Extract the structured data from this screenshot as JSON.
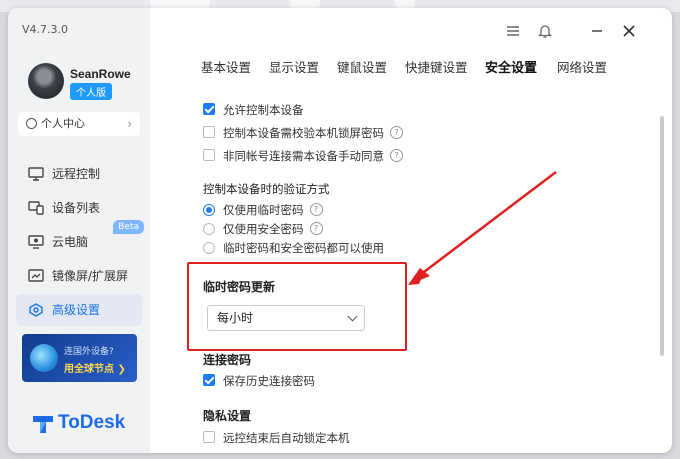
{
  "app": {
    "version": "V4.7.3.0",
    "user": {
      "name": "SeanRowe",
      "plan_badge": "个人版"
    },
    "personal_center": "个人中心"
  },
  "sidebar": {
    "items": [
      {
        "label": "远程控制",
        "icon": "monitor-icon"
      },
      {
        "label": "设备列表",
        "icon": "devices-icon"
      },
      {
        "label": "云电脑",
        "icon": "cloud-pc-icon",
        "badge": "Beta"
      },
      {
        "label": "镜像屏/扩展屏",
        "icon": "mirror-screen-icon"
      },
      {
        "label": "高级设置",
        "icon": "advanced-settings-icon",
        "active": true
      }
    ],
    "promo": {
      "line1": "连国外设备?",
      "line2": "用全球节点 ❯"
    },
    "brand": "ToDesk"
  },
  "tabs": [
    "基本设置",
    "显示设置",
    "键鼠设置",
    "快捷键设置",
    "安全设置",
    "网络设置"
  ],
  "active_tab": "安全设置",
  "security": {
    "allow_control": {
      "label": "允许控制本设备",
      "checked": true
    },
    "require_lock_password": {
      "label": "控制本设备需校验本机锁屏密码",
      "checked": false
    },
    "manual_consent": {
      "label": "非同帐号连接需本设备手动同意",
      "checked": false
    },
    "verify_section_title": "控制本设备时的验证方式",
    "verify_options": [
      {
        "label": "仅使用临时密码",
        "selected": true
      },
      {
        "label": "仅使用安全密码",
        "selected": false
      },
      {
        "label": "临时密码和安全密码都可以使用",
        "selected": false
      }
    ],
    "temp_password_update": {
      "title": "临时密码更新",
      "value": "每小时"
    },
    "connection_password": {
      "title": "连接密码",
      "save_history": {
        "label": "保存历史连接密码",
        "checked": true
      }
    },
    "privacy": {
      "title": "隐私设置",
      "auto_lock": {
        "label": "远控结束后自动锁定本机",
        "checked": false
      }
    }
  },
  "colors": {
    "accent": "#1e7cf2",
    "highlight_box": "#e02020",
    "brand": "#1e6be6"
  }
}
